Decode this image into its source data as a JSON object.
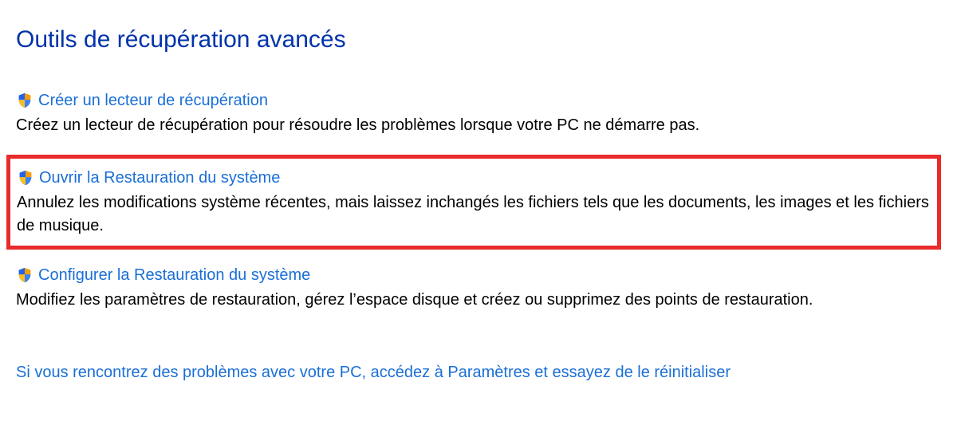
{
  "title": "Outils de récupération avancés",
  "options": [
    {
      "link": "Créer un lecteur de récupération",
      "desc": "Créez un lecteur de récupération pour résoudre les problèmes lorsque votre PC ne démarre pas.",
      "highlighted": false
    },
    {
      "link": "Ouvrir la Restauration du système",
      "desc": "Annulez les modifications système récentes, mais laissez inchangés les fichiers tels que les documents, les images et les fichiers de musique.",
      "highlighted": true
    },
    {
      "link": "Configurer la Restauration du système",
      "desc": "Modifiez les paramètres de restauration, gérez l’espace disque et créez ou supprimez des points de restauration.",
      "highlighted": false
    }
  ],
  "footer_link": "Si vous rencontrez des problèmes avec votre PC, accédez à Paramètres et essayez de le réinitialiser"
}
